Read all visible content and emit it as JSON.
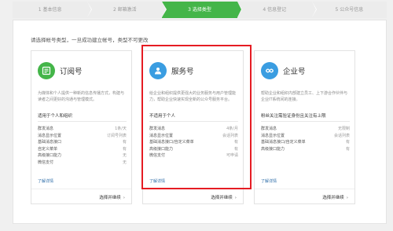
{
  "steps": [
    {
      "label": "1 基本信息",
      "active": false
    },
    {
      "label": "2 邮箱激活",
      "active": false
    },
    {
      "label": "3 选择类型",
      "active": true
    },
    {
      "label": "4 信息登记",
      "active": false
    },
    {
      "label": "5 公众号信息",
      "active": false
    }
  ],
  "hint": "请选择帐号类型，一旦成功建立帐号，类型不可更改",
  "colors": {
    "accent_green": "#44b549",
    "highlight_red": "#e51c23",
    "link_blue": "#2f6ea9"
  },
  "cards": [
    {
      "icon": "subscription-icon",
      "icon_color": "#44b549",
      "title": "订阅号",
      "desc": "为媒体和个人提供一种新的信息传播方式，构建与读者之间更好的沟通与管理模式。",
      "tag": "适用于个人和组织",
      "features": [
        {
          "k": "群发消息",
          "v": "1条/天"
        },
        {
          "k": "消息显示位置",
          "v": "订阅号列表"
        },
        {
          "k": "基础消息接口",
          "v": "有"
        },
        {
          "k": "自定义菜单",
          "v": "有"
        },
        {
          "k": "高级接口能力",
          "v": "无"
        },
        {
          "k": "微信支付",
          "v": "无"
        }
      ],
      "more": "了解详情",
      "select": "选择并继续"
    },
    {
      "icon": "service-icon",
      "icon_color": "#3a9de1",
      "title": "服务号",
      "desc": "给企业和组织提供更强大的业务服务与用户管理能力，帮助企业快速实现全新的公众号服务平台。",
      "tag": "不适用于个人",
      "features": [
        {
          "k": "群发消息",
          "v": "4条/月"
        },
        {
          "k": "消息显示位置",
          "v": "会话列表"
        },
        {
          "k": "基础消息接口/自定义菜单",
          "v": "有"
        },
        {
          "k": "高级接口能力",
          "v": "有"
        },
        {
          "k": "微信支付",
          "v": "可申请"
        }
      ],
      "more": "了解详情",
      "select": "选择并继续"
    },
    {
      "icon": "enterprise-icon",
      "icon_color": "#3a9de1",
      "title": "企业号",
      "desc": "帮助企业和组织内部建立员工、上下游合作伙伴与企业IT系统间的连接。",
      "tag": "粉丝关注需验证身份且关注有上限",
      "features": [
        {
          "k": "群发消息",
          "v": "无限制"
        },
        {
          "k": "消息显示位置",
          "v": "会话列表"
        },
        {
          "k": "基础消息接口/自定义菜单",
          "v": "有"
        },
        {
          "k": "高级接口能力",
          "v": "有"
        }
      ],
      "more": "了解详情",
      "select": "选择并继续"
    }
  ]
}
